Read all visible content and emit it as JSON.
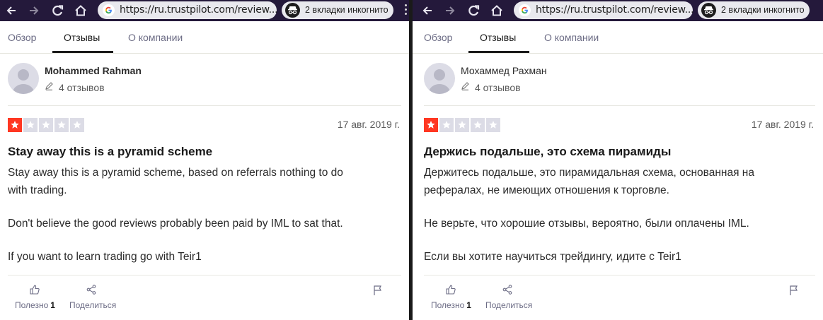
{
  "panels": [
    {
      "browser": {
        "url": "https://ru.trustpilot.com/review...",
        "incognito_label": "2 вкладки инкогнито"
      },
      "tabs": [
        "Обзор",
        "Отзывы",
        "О компании"
      ],
      "reviewer": {
        "name": "Mohammed Rahman",
        "review_count": "4 отзывов"
      },
      "rating": {
        "stars": 1,
        "max": 5
      },
      "date": "17 авг. 2019 г.",
      "title": "Stay away this is a pyramid scheme",
      "body": [
        "Stay away this is a pyramid scheme, based on referrals nothing to do\nwith trading.",
        "Don't believe the good reviews probably been paid by IML to sat that.",
        "If you want to learn trading go with Teir1"
      ],
      "actions": {
        "useful_label": "Полезно",
        "useful_count": "1",
        "share_label": "Поделиться"
      }
    },
    {
      "browser": {
        "url": "https://ru.trustpilot.com/review...",
        "incognito_label": "2 вкладки инкогнито"
      },
      "tabs": [
        "Обзор",
        "Отзывы",
        "О компании"
      ],
      "reviewer": {
        "name": "Мохаммед Рахман",
        "review_count": "4 отзывов"
      },
      "rating": {
        "stars": 1,
        "max": 5
      },
      "date": "17 авг. 2019 г.",
      "title": "Держись подальше, это схема пирамиды",
      "body": [
        "Держитесь подальше, это пирамидальная схема, основанная на\nрефералах, не имеющих отношения к торговле.",
        "Не верьте, что хорошие отзывы, вероятно, были оплачены IML.",
        "Если вы хотите научиться трейдингу, идите с Teir1"
      ],
      "actions": {
        "useful_label": "Полезно",
        "useful_count": "1",
        "share_label": "Поделиться"
      }
    }
  ],
  "colors": {
    "browser_bar": "#24193b",
    "star_active": "#ff3722",
    "star_inactive": "#dcdce6"
  },
  "icons": [
    "back-arrow-icon",
    "forward-arrow-icon",
    "reload-icon",
    "home-icon",
    "google-icon",
    "incognito-icon",
    "menu-dots-icon",
    "pencil-icon",
    "star-icon",
    "thumbs-up-icon",
    "share-icon",
    "flag-icon"
  ]
}
